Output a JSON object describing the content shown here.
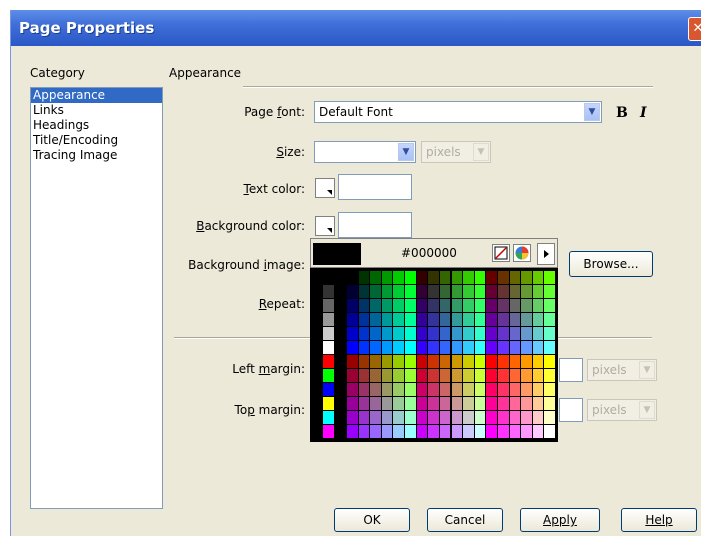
{
  "window": {
    "title": "Page Properties"
  },
  "category": {
    "label": "Category",
    "items": [
      "Appearance",
      "Links",
      "Headings",
      "Title/Encoding",
      "Tracing Image"
    ],
    "selected": "Appearance"
  },
  "section": {
    "title": "Appearance"
  },
  "page_font": {
    "label_pre": "Page ",
    "label_key": "f",
    "label_post": "ont:",
    "value": "Default Font",
    "bold": "B",
    "italic": "I"
  },
  "size": {
    "label_pre": "",
    "label_key": "S",
    "label_post": "ize:",
    "value": "",
    "unit": "pixels"
  },
  "text_color": {
    "label_pre": "",
    "label_key": "T",
    "label_post": "ext color:",
    "value": ""
  },
  "bg_color": {
    "label_pre": "",
    "label_key": "B",
    "label_post": "ackground color:",
    "value": ""
  },
  "bg_image": {
    "label_pre": "Background ",
    "label_key": "i",
    "label_post": "mage:",
    "browse": "Browse..."
  },
  "repeat": {
    "label_pre": "",
    "label_key": "R",
    "label_post": "epeat:"
  },
  "left_margin": {
    "label_pre": "Left ",
    "label_key": "m",
    "label_post": "argin:",
    "unit": "pixels"
  },
  "top_margin": {
    "label_pre": "To",
    "label_key": "p",
    "label_post": " margin:",
    "unit": "pixels"
  },
  "picker": {
    "hex": "#000000"
  },
  "buttons": {
    "ok": "OK",
    "cancel": "Cancel",
    "apply": "Apply",
    "help": "Help"
  },
  "colors": {
    "titlebar": "#2a58c7",
    "dialog_bg": "#ece9d8",
    "selection": "#316ac5"
  }
}
